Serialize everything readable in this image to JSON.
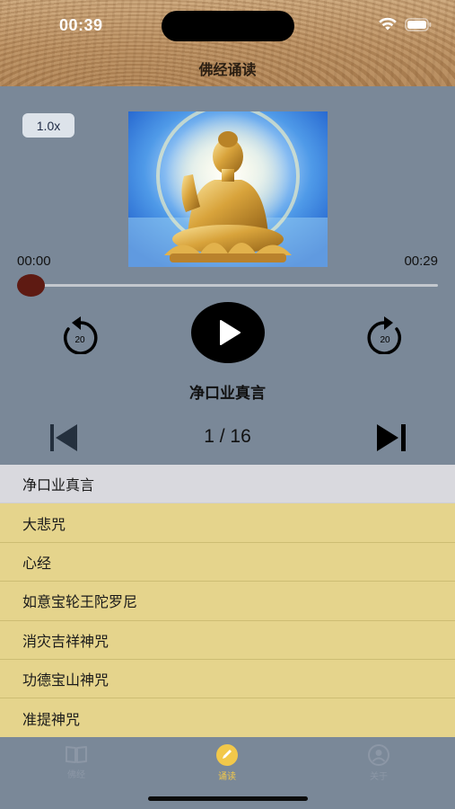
{
  "status_bar": {
    "time": "00:39"
  },
  "nav": {
    "title": "佛经诵读"
  },
  "player": {
    "speed": "1.0x",
    "current_time": "00:00",
    "total_time": "00:29",
    "progress": 0,
    "skip_back_seconds": "20",
    "skip_forward_seconds": "20",
    "track_title": "净口业真言",
    "counter": "1 / 16",
    "cover_icon": "buddha-image"
  },
  "list": {
    "items": [
      {
        "label": "净口业真言",
        "active": true
      },
      {
        "label": "大悲咒"
      },
      {
        "label": "心经"
      },
      {
        "label": "如意宝轮王陀罗尼"
      },
      {
        "label": "消灾吉祥神咒"
      },
      {
        "label": "功德宝山神咒"
      },
      {
        "label": "准提神咒"
      }
    ]
  },
  "tabbar": {
    "tabs": [
      {
        "label": "佛经",
        "icon": "book-icon"
      },
      {
        "label": "诵读",
        "icon": "pencil-icon",
        "active": true
      },
      {
        "label": "关于",
        "icon": "person-icon"
      }
    ]
  },
  "colors": {
    "player_bg": "#7a8898",
    "list_bg": "#e5d48c",
    "active_row": "#d9d9de",
    "seek_thumb": "#5e1a12",
    "tab_active": "#f2c84a"
  }
}
